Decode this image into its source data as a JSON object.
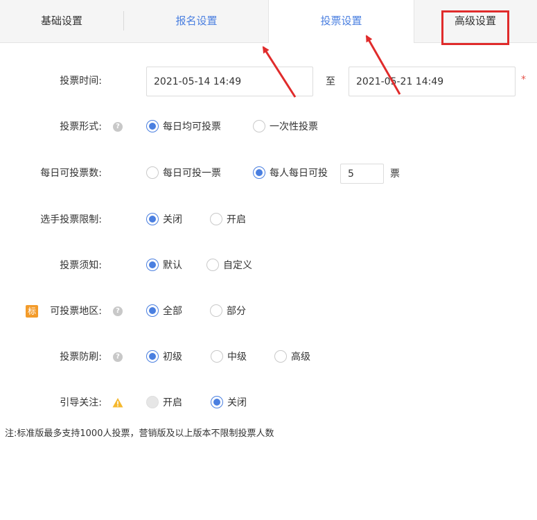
{
  "tabs": [
    {
      "label": "基础设置"
    },
    {
      "label": "报名设置"
    },
    {
      "label": "投票设置"
    },
    {
      "label": "高级设置"
    }
  ],
  "form": {
    "vote_time": {
      "label": "投票时间:",
      "start": "2021-05-14 14:49",
      "to": "至",
      "end": "2021-05-21 14:49",
      "required_mark": "*"
    },
    "vote_form": {
      "label": "投票形式:",
      "options": [
        "每日均可投票",
        "一次性投票"
      ],
      "selected": 0
    },
    "daily_votes": {
      "label": "每日可投票数:",
      "opt1": "每日可投一票",
      "opt2": "每人每日可投",
      "count": "5",
      "unit": "票",
      "selected": 1
    },
    "contestant_limit": {
      "label": "选手投票限制:",
      "options": [
        "关闭",
        "开启"
      ],
      "selected": 0
    },
    "vote_notice": {
      "label": "投票须知:",
      "options": [
        "默认",
        "自定义"
      ],
      "selected": 0
    },
    "vote_region": {
      "badge": "标",
      "label": "可投票地区:",
      "options": [
        "全部",
        "部分"
      ],
      "selected": 0
    },
    "anti_fraud": {
      "label": "投票防刷:",
      "options": [
        "初级",
        "中级",
        "高级"
      ],
      "selected": 0
    },
    "guide_follow": {
      "label": "引导关注:",
      "options": [
        "开启",
        "关闭"
      ],
      "selected": 1
    }
  },
  "note": "注:标准版最多支持1000人投票，营销版及以上版本不限制投票人数",
  "icons": {
    "help": "question-circle-icon",
    "warning": "warning-triangle-icon"
  },
  "colors": {
    "accent": "#4a7fe0",
    "annotation": "#e02b2b",
    "badge": "#f39b2a"
  }
}
